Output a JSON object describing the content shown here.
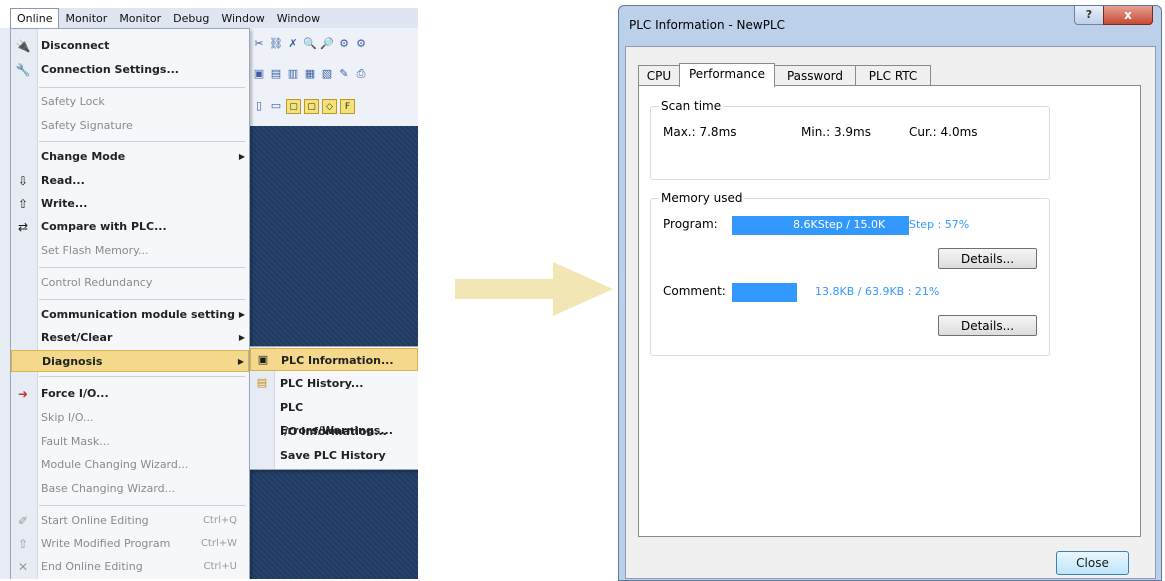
{
  "menubar": {
    "items": [
      "Online",
      "Monitor",
      "Monitor",
      "Debug",
      "Window",
      "Window"
    ]
  },
  "online_menu": {
    "items": [
      {
        "label": "Disconnect",
        "icon": "disconnect-icon",
        "style": "bold"
      },
      {
        "label": "Connection Settings...",
        "icon": "connection-settings-icon",
        "style": "bold"
      },
      {
        "label": "Safety Lock",
        "style": "disabled"
      },
      {
        "label": "Safety Signature",
        "style": "disabled"
      },
      {
        "label": "Change Mode",
        "style": "bold",
        "submenu": true
      },
      {
        "label": "Read...",
        "icon": "read-icon",
        "style": "bold"
      },
      {
        "label": "Write...",
        "icon": "write-icon",
        "style": "bold"
      },
      {
        "label": "Compare with PLC...",
        "icon": "compare-icon",
        "style": "bold"
      },
      {
        "label": "Set Flash Memory...",
        "style": "disabled"
      },
      {
        "label": "Control Redundancy",
        "style": "disabled"
      },
      {
        "label": "Communication module setting",
        "style": "bold",
        "submenu": true
      },
      {
        "label": "Reset/Clear",
        "style": "bold",
        "submenu": true
      },
      {
        "label": "Diagnosis",
        "style": "bold",
        "submenu": true,
        "selected": true
      },
      {
        "label": "Force I/O...",
        "icon": "force-io-icon",
        "style": "bold"
      },
      {
        "label": "Skip I/O...",
        "style": "disabled"
      },
      {
        "label": "Fault Mask...",
        "style": "disabled"
      },
      {
        "label": "Module Changing Wizard...",
        "style": "disabled"
      },
      {
        "label": "Base Changing Wizard...",
        "style": "disabled"
      },
      {
        "label": "Start Online Editing",
        "shortcut": "Ctrl+Q",
        "icon": "start-edit-icon",
        "style": "disabled"
      },
      {
        "label": "Write Modified Program",
        "shortcut": "Ctrl+W",
        "icon": "write-modified-icon",
        "style": "disabled"
      },
      {
        "label": "End Online Editing",
        "shortcut": "Ctrl+U",
        "icon": "end-edit-icon",
        "style": "disabled"
      }
    ]
  },
  "diagnosis_submenu": {
    "items": [
      {
        "label": "PLC Information...",
        "icon": "plc-info-icon",
        "selected": true
      },
      {
        "label": "PLC History...",
        "icon": "plc-history-icon"
      },
      {
        "label": "PLC Errors/Warnings..."
      },
      {
        "label": "I/O Information..."
      },
      {
        "label": "Save PLC History"
      }
    ]
  },
  "dialog": {
    "title": "PLC Information - NewPLC",
    "help_label": "?",
    "close_x": "x",
    "tabs": [
      "CPU",
      "Performance",
      "Password",
      "PLC RTC"
    ],
    "active_tab": "Performance",
    "scan_time": {
      "title": "Scan time",
      "max": "Max.: 7.8ms",
      "min": "Min.: 3.9ms",
      "cur": "Cur.: 4.0ms"
    },
    "memory": {
      "title": "Memory used",
      "program_label": "Program:",
      "program_bar_text": "8.6KStep / 15.0K",
      "program_rest_text": "Step : 57%",
      "program_percent": 57,
      "comment_label": "Comment:",
      "comment_text": "13.8KB / 63.9KB : 21%",
      "comment_percent": 21,
      "details_label": "Details..."
    },
    "close_button": "Close"
  },
  "colors": {
    "progress": "#3399ff",
    "selection": "#f4d98c",
    "arrow": "#f3e6b5",
    "desktop": "#1f3b63"
  }
}
